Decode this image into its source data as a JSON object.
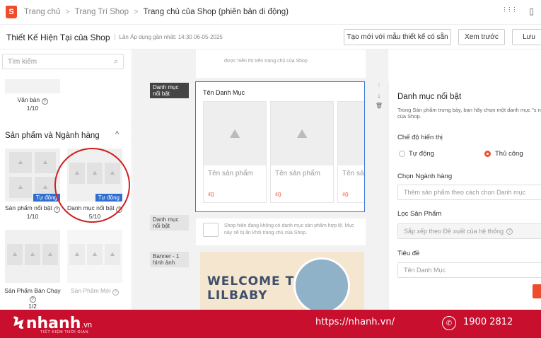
{
  "breadcrumb": {
    "logo": "S",
    "items": [
      "Trang chủ",
      "Trang Trí Shop",
      "Trang chủ của Shop (phiên bản di động)"
    ],
    "separator": ">"
  },
  "top_icons": {
    "apps": "⋮⋮⋮",
    "book": "▯"
  },
  "header": {
    "title": "Thiết Kế Hiện Tại của Shop",
    "last_applied": "Lần Áp dụng gần nhất: 14:30 06-05-2025",
    "create_label": "Tạo mới với mẫu thiết kế có sẵn",
    "preview_label": "Xem trước",
    "save_label": "Lưu"
  },
  "left_panel": {
    "search_placeholder": "Tìm kiếm",
    "search_icon": "⌕",
    "van_ban": {
      "label": "Văn bản",
      "count": "1/10"
    },
    "section_title": "Sản phẩm và Ngành hàng",
    "section_caret": "^",
    "widgets": [
      {
        "label": "Sản phẩm nổi bật",
        "count": "1/10",
        "badge": "Tự động"
      },
      {
        "label": "Danh mục nổi bật",
        "count": "5/10",
        "badge": "Tự động"
      },
      {
        "label": "Sản Phẩm Bán Chạy",
        "count": "1/2"
      },
      {
        "label": "Sản Phẩm Mới",
        "count": ""
      }
    ],
    "help_glyph": "?",
    "collapse_glyph": "<"
  },
  "canvas": {
    "top_note": "được hiển thị trên trang chủ của Shop",
    "tags": {
      "selected": "Danh mục nổi bật",
      "second": "Danh mục nổi bật",
      "banner": "Banner - 1 hình ảnh"
    },
    "selected_card": {
      "title": "Tên Danh Mục",
      "products": [
        {
          "name": "Tên sản phẩm",
          "price": "₫0"
        },
        {
          "name": "Tên sản phẩm",
          "price": "₫0"
        },
        {
          "name": "Tên sản phẩm",
          "price": "₫0"
        }
      ],
      "image_glyph": "⛰"
    },
    "tools": {
      "up": "↑",
      "down": "↓",
      "delete": "🗑"
    },
    "empty_note": "Shop hiện đang không có danh mục sản phẩm hợp lệ. Mục này sẽ bị ẩn khỏi trang chủ của Shop.",
    "banner_text_1": "WELCOME TO",
    "banner_text_2": "LILBABY"
  },
  "right_panel": {
    "title": "Danh mục nổi bật",
    "desc": "Trong Sản phẩm trưng bày, bạn hãy chọn một danh mục \"s nhất của Shop.",
    "display_mode_label": "Chế độ hiển thị",
    "mode_auto": "Tự động",
    "mode_manual": "Thủ công",
    "category_label": "Chọn Ngành hàng",
    "category_placeholder": "Thêm sản phẩm theo cách chọn Danh mục",
    "filter_label": "Lọc Sản Phẩm",
    "filter_value": "Sắp xếp theo Đề xuất của hệ thống",
    "heading_label": "Tiêu đề",
    "heading_placeholder": "Tên Danh Mục"
  },
  "footer": {
    "brand_mark": "Ϟ",
    "brand": "nhanh",
    "brand_tld": ".vn",
    "tagline": "TIẾT KIỆM THỜI GIAN",
    "url": "https://nhanh.vn/",
    "phone_icon": "✆",
    "phone": "1900 2812"
  }
}
